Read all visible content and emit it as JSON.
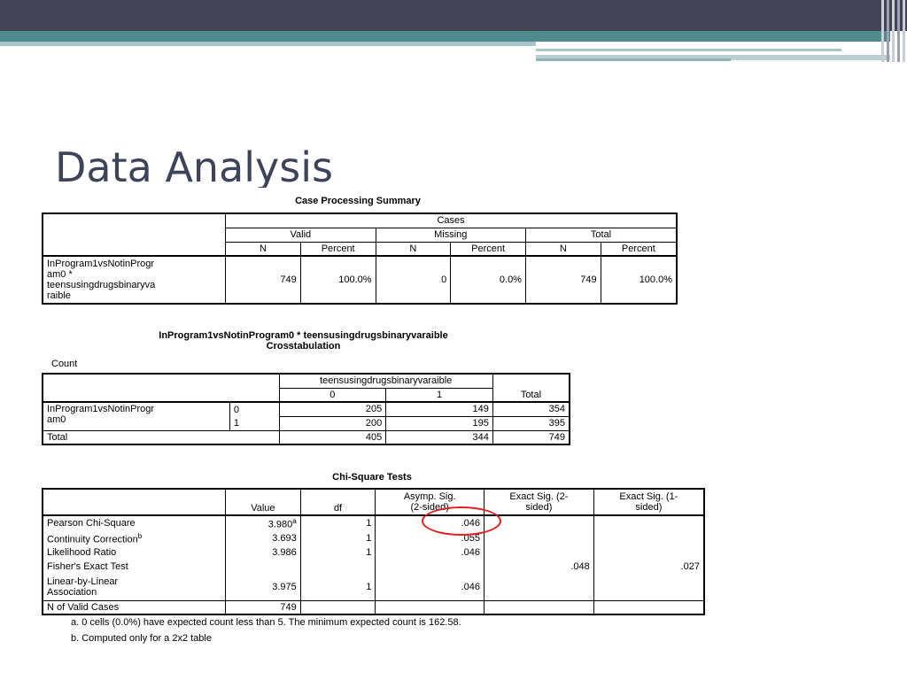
{
  "slide": {
    "title": "Data Analysis"
  },
  "case_summary": {
    "caption": "Case Processing Summary",
    "cases_header": "Cases",
    "groups": [
      "Valid",
      "Missing",
      "Total"
    ],
    "subheads": [
      "N",
      "Percent",
      "N",
      "Percent",
      "N",
      "Percent"
    ],
    "row_label_lines": [
      "InProgram1vsNotinProgr",
      "am0 *",
      "teensusingdrugsbinaryva",
      "raible"
    ],
    "values": [
      "749",
      "100.0%",
      "0",
      "0.0%",
      "749",
      "100.0%"
    ]
  },
  "crosstab": {
    "caption_line1": "InProgram1vsNotinProgram0 * teensusingdrugsbinaryvaraible",
    "caption_line2": "Crosstabulation",
    "count_label": "Count",
    "col_var": "teensusingdrugsbinaryvaraible",
    "col_0": "0",
    "col_1": "1",
    "total_header": "Total",
    "row_var_line1": "InProgram1vsNotinProgr",
    "row_var_line2": "am0",
    "rows": [
      {
        "level": "0",
        "v0": "205",
        "v1": "149",
        "total": "354"
      },
      {
        "level": "1",
        "v0": "200",
        "v1": "195",
        "total": "395"
      }
    ],
    "total_row": {
      "label": "Total",
      "v0": "405",
      "v1": "344",
      "total": "749"
    }
  },
  "chisq": {
    "caption": "Chi-Square Tests",
    "headers": {
      "value": "Value",
      "df": "df",
      "asymp_l1": "Asymp. Sig.",
      "asymp_l2": "(2-sided)",
      "exact2_l1": "Exact Sig. (2-",
      "exact2_l2": "sided)",
      "exact1_l1": "Exact Sig. (1-",
      "exact1_l2": "sided)"
    },
    "rows": [
      {
        "label": "Pearson Chi-Square",
        "value": "3.980",
        "sup": "a",
        "df": "1",
        "asymp": ".046",
        "exact2": "",
        "exact1": ""
      },
      {
        "label": "Continuity Correction",
        "sup": "b",
        "value": "3.693",
        "df": "1",
        "asymp": ".055",
        "exact2": "",
        "exact1": ""
      },
      {
        "label": "Likelihood Ratio",
        "value": "3.986",
        "df": "1",
        "asymp": ".046",
        "exact2": "",
        "exact1": ""
      },
      {
        "label": "Fisher's Exact Test",
        "value": "",
        "df": "",
        "asymp": "",
        "exact2": ".048",
        "exact1": ".027"
      },
      {
        "label_l1": "Linear-by-Linear",
        "label_l2": "Association",
        "value": "3.975",
        "df": "1",
        "asymp": ".046",
        "exact2": "",
        "exact1": ""
      },
      {
        "label": "N of Valid Cases",
        "value": "749",
        "df": "",
        "asymp": "",
        "exact2": "",
        "exact1": ""
      }
    ],
    "footnote_a": "a. 0 cells (0.0%) have expected count less than 5. The minimum expected count is 162.58.",
    "footnote_b": "b. Computed only for a 2x2 table"
  },
  "colors": {
    "header_dark": "#424456",
    "header_teal": "#4f8a8e",
    "title": "#3d4459",
    "highlight_circle": "#e0201c"
  }
}
